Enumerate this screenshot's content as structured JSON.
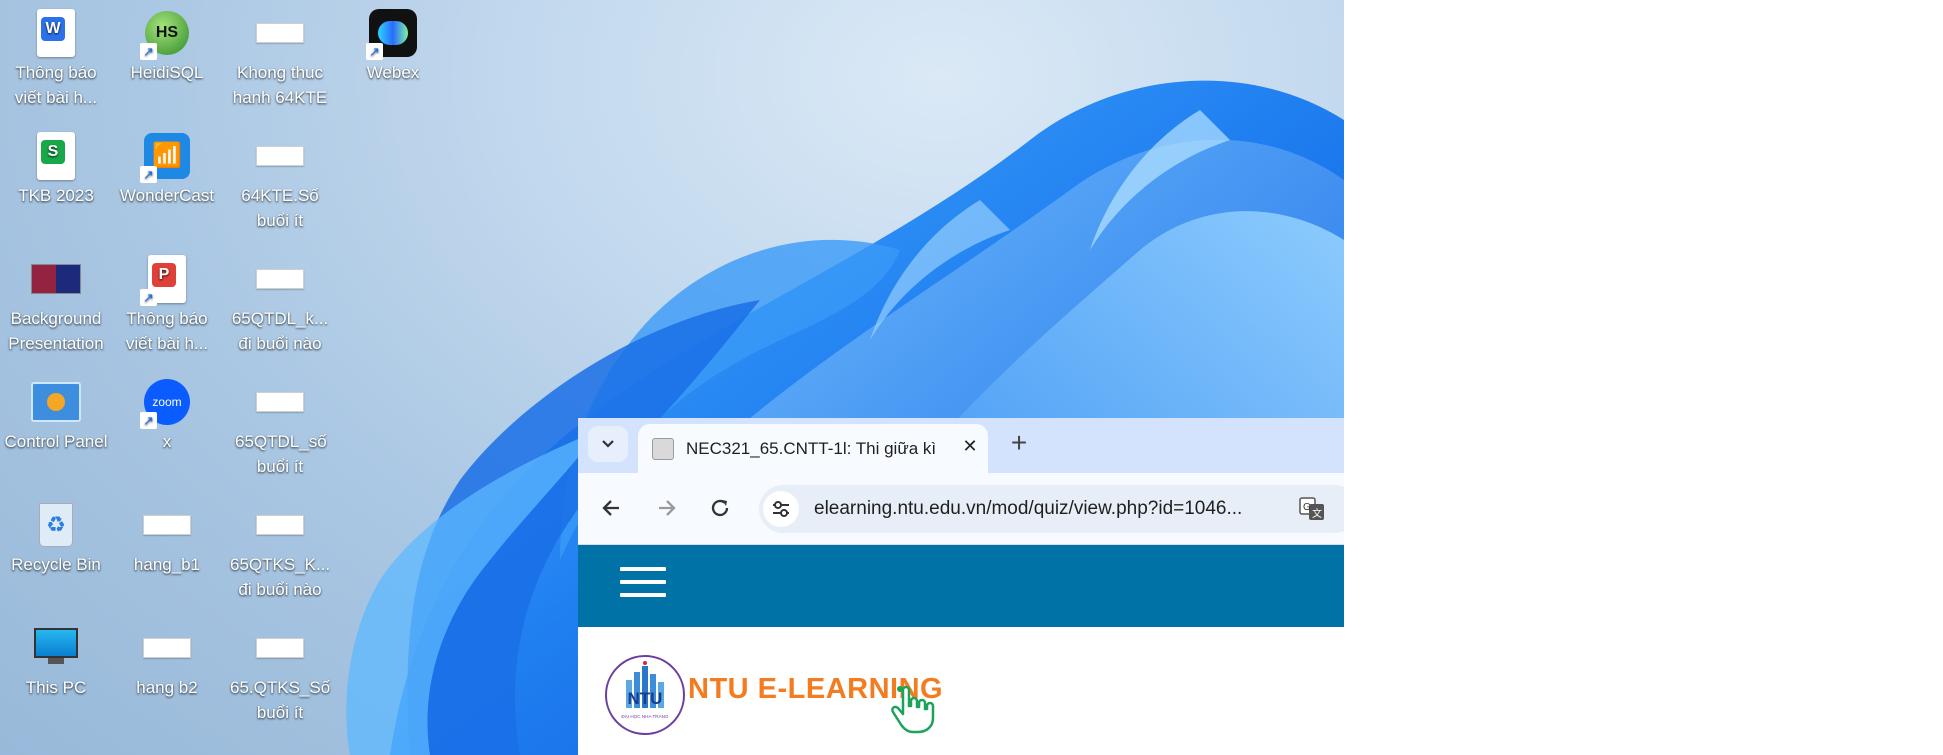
{
  "desktop": {
    "icons": [
      {
        "label": "Thông báo viết bài h...",
        "icon": "word-document-icon"
      },
      {
        "label": "HeidiSQL",
        "icon": "heidisql-icon"
      },
      {
        "label": "Khong thuc hanh 64KTE",
        "icon": "spreadsheet-thumbnail-icon"
      },
      {
        "label": "Webex",
        "icon": "webex-icon"
      },
      {
        "label": "TKB 2023",
        "icon": "sheet-document-icon"
      },
      {
        "label": "WonderCast",
        "icon": "wondercast-icon"
      },
      {
        "label": "64KTE.Số buổi ít",
        "icon": "spreadsheet-thumbnail-icon"
      },
      {
        "label": "Background Presentation",
        "icon": "presentation-thumbnail-icon"
      },
      {
        "label": "Thông báo viết bài h...",
        "icon": "pdf-document-icon"
      },
      {
        "label": "65QTDL_k... đi buổi nào",
        "icon": "spreadsheet-thumbnail-icon"
      },
      {
        "label": "Control Panel",
        "icon": "control-panel-icon"
      },
      {
        "label": "x",
        "icon": "zoom-icon"
      },
      {
        "label": "65QTDL_số buổi ít",
        "icon": "spreadsheet-thumbnail-icon"
      },
      {
        "label": "Recycle Bin",
        "icon": "recycle-bin-icon"
      },
      {
        "label": "hang_b1",
        "icon": "spreadsheet-thumbnail-icon"
      },
      {
        "label": "65QTKS_K... đi buổi nào",
        "icon": "spreadsheet-thumbnail-icon"
      },
      {
        "label": "This PC",
        "icon": "monitor-icon"
      },
      {
        "label": "hang b2",
        "icon": "spreadsheet-thumbnail-icon"
      },
      {
        "label": "65.QTKS_Số buổi ít",
        "icon": "spreadsheet-thumbnail-icon"
      }
    ]
  },
  "browser": {
    "tab": {
      "title": "NEC321_65.CNTT-1l: Thi giữa kì",
      "close_label": "✕"
    },
    "new_tab_label": "+",
    "address": {
      "url": "elearning.ntu.edu.vn/mod/quiz/view.php?id=1046..."
    },
    "page": {
      "logo_text": "NTU E-LEARNING",
      "seal_text": "NTU",
      "seal_caption": "ĐẠI HỌC NHA TRANG"
    }
  },
  "colors": {
    "site_nav": "#0072a5",
    "logo_orange": "#f47c20",
    "tabstrip": "#d3e3fd"
  }
}
